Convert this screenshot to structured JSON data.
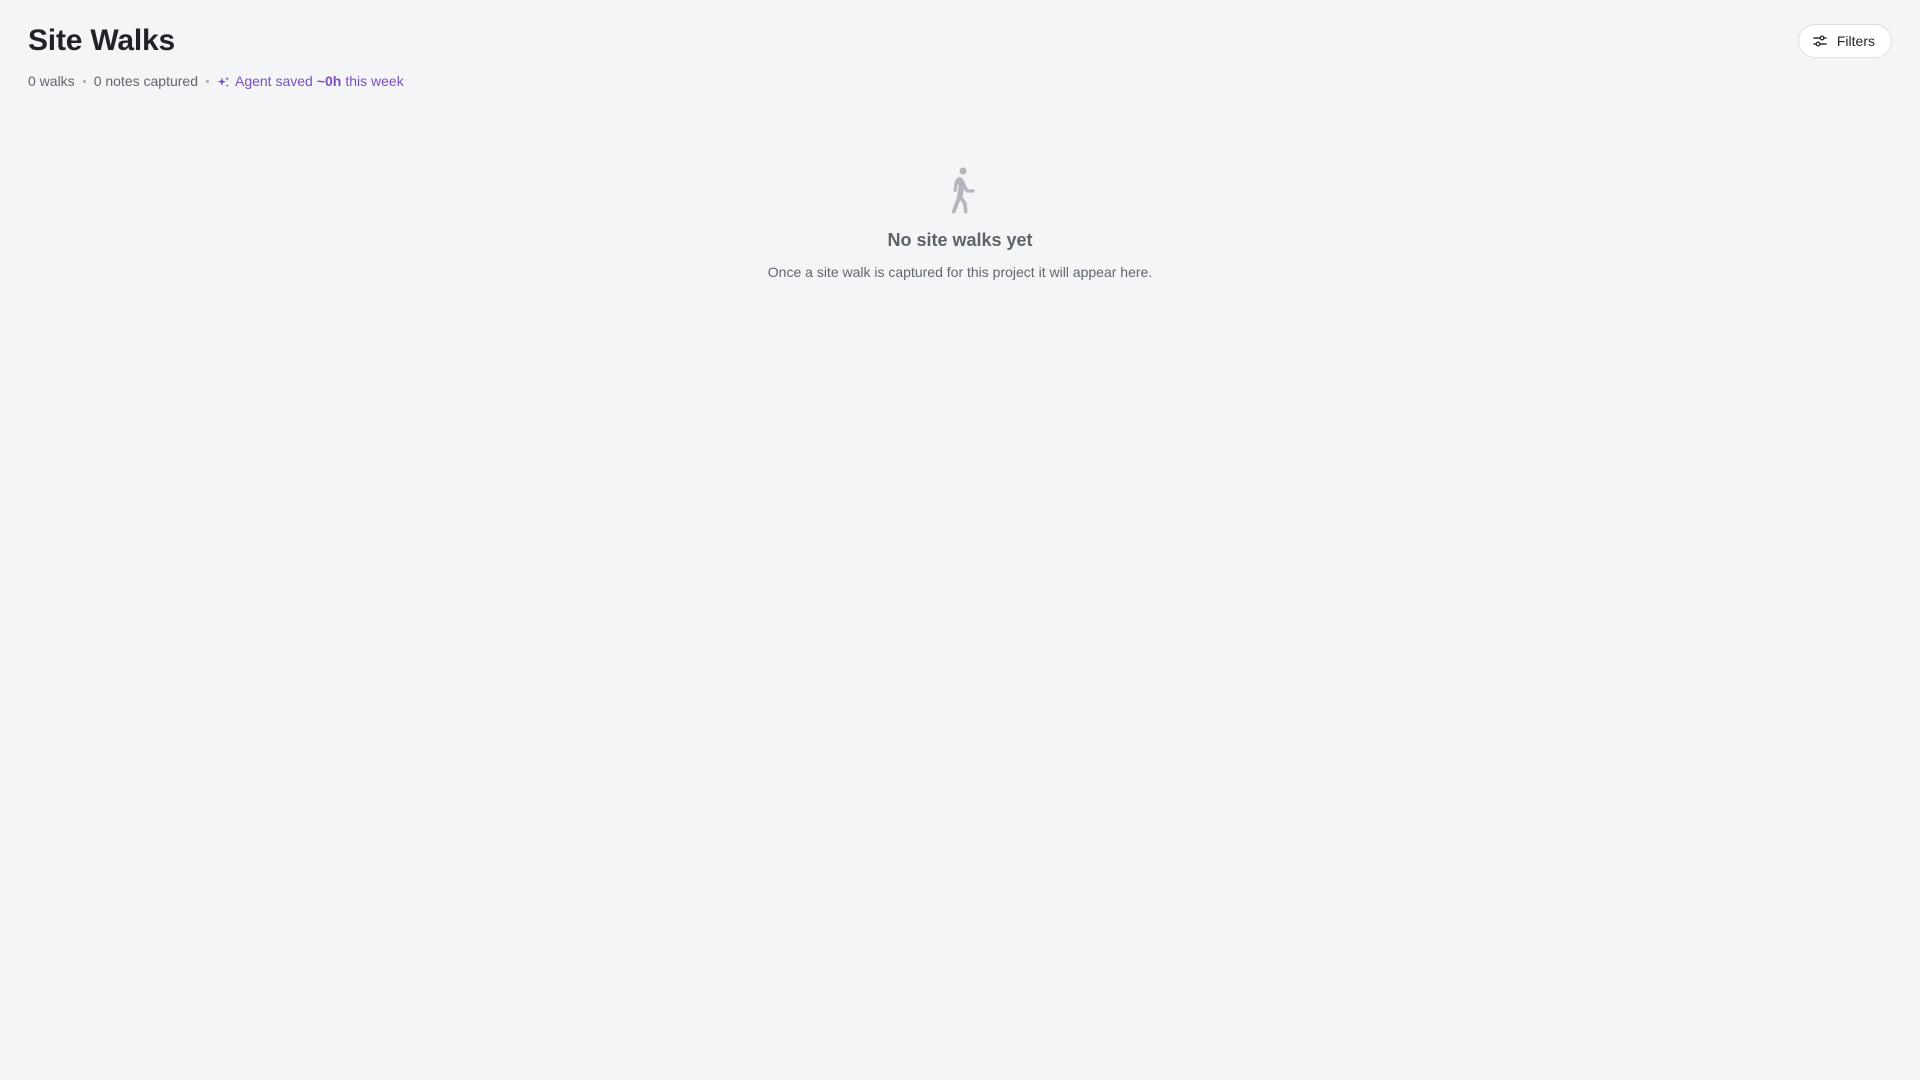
{
  "header": {
    "title": "Site Walks",
    "walks_count": "0 walks",
    "notes_count": "0 notes captured",
    "agent_prefix": "Agent saved",
    "agent_value": "~0h",
    "agent_suffix": "this week"
  },
  "toolbar": {
    "filters_label": "Filters"
  },
  "empty_state": {
    "title": "No site walks yet",
    "subtitle": "Once a site walk is captured for this project it will appear here."
  },
  "icons": {
    "sparkle": "sparkle-icon",
    "filters": "sliders-icon",
    "empty": "walking-person-icon"
  },
  "colors": {
    "background": "#f4f5f7",
    "accent": "#7a4fc4",
    "muted_icon": "#b3b7bd"
  }
}
